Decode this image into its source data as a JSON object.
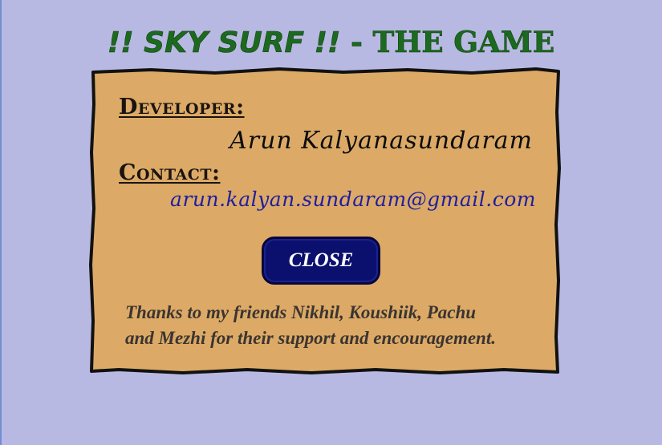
{
  "title": {
    "part1": "!! SKY SURF !!",
    "part2": " - THE GAME"
  },
  "credits": {
    "developer_label": "Developer:",
    "developer_name": "Arun Kalyanasundaram",
    "contact_label": "Contact:",
    "email": "arun.kalyan.sundaram@gmail.com",
    "close_label": "CLOSE",
    "thanks_line1": "Thanks to my friends Nikhil, Koushiik, Pachu",
    "thanks_line2": "and Mezhi for their support and encouragement."
  },
  "colors": {
    "background": "#b8b9e2",
    "title": "#1c6a1f",
    "panel": "#dcaa66",
    "panel_border": "#111111",
    "email": "#1f1ea0",
    "button": "#0b0f6e"
  }
}
